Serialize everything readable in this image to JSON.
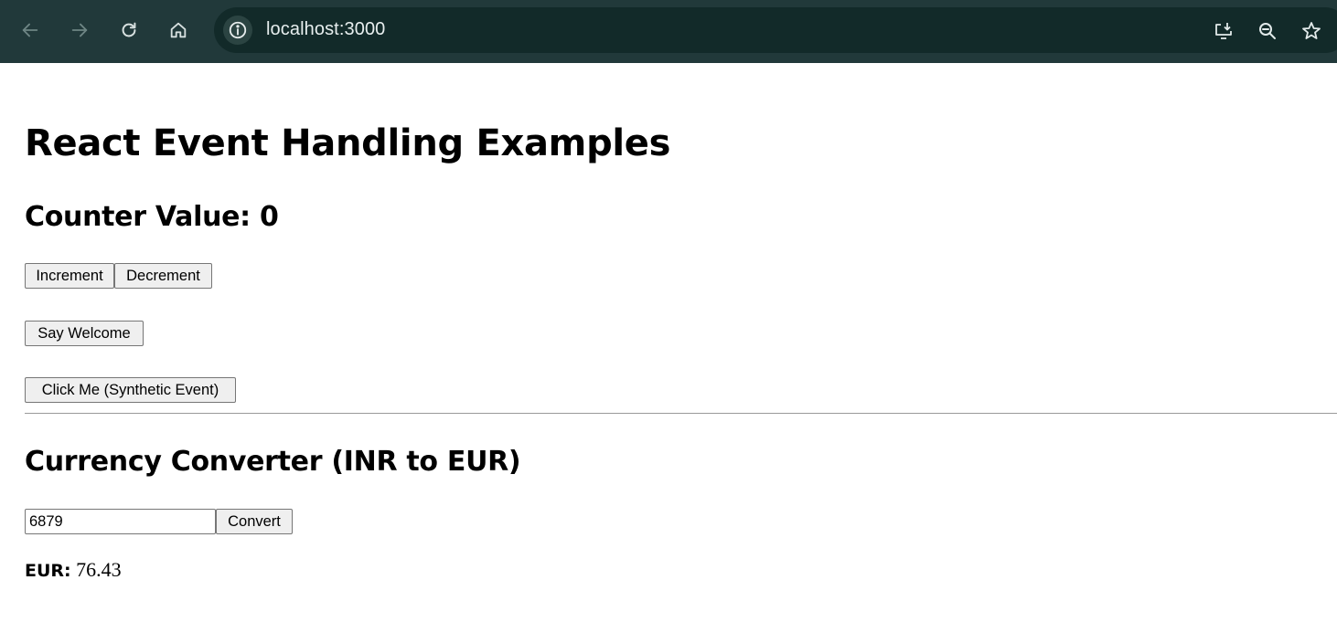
{
  "browser": {
    "url": "localhost:3000",
    "icons": {
      "back": "arrow-left-icon",
      "forward": "arrow-right-icon",
      "reload": "reload-icon",
      "home": "home-icon",
      "site_info": "info-icon",
      "install": "install-app-icon",
      "zoom": "zoom-icon",
      "bookmark": "star-icon"
    }
  },
  "page": {
    "title": "React Event Handling Examples",
    "counter": {
      "heading": "Counter Value: 0",
      "increment_label": "Increment",
      "decrement_label": "Decrement"
    },
    "welcome_button_label": "Say Welcome",
    "synthetic_button_label": "Click Me (Synthetic Event)",
    "converter": {
      "heading": "Currency Converter (INR to EUR)",
      "input_value": "6879",
      "convert_label": "Convert",
      "result_label": "EUR:",
      "result_value": " 76.43"
    }
  },
  "colors": {
    "chrome_background": "#21393a",
    "omnibox_background": "#122a29",
    "button_background": "#efefef",
    "button_border": "#767676"
  }
}
